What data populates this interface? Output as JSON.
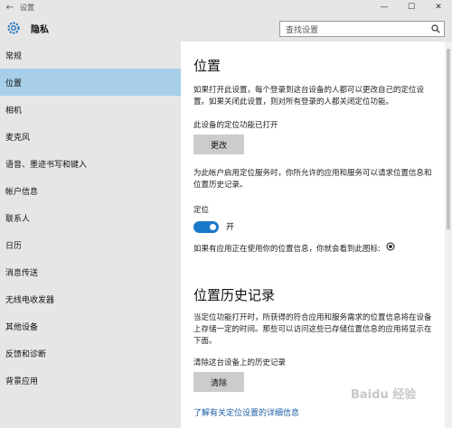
{
  "window": {
    "back": "←",
    "title": "设置",
    "min": "—",
    "max": "☐",
    "close": "✕"
  },
  "header": {
    "title": "隐私",
    "search_placeholder": "查找设置"
  },
  "sidebar": {
    "items": [
      {
        "label": "常规"
      },
      {
        "label": "位置"
      },
      {
        "label": "相机"
      },
      {
        "label": "麦克风"
      },
      {
        "label": "语音、墨迹书写和键入"
      },
      {
        "label": "帐户信息"
      },
      {
        "label": "联系人"
      },
      {
        "label": "日历"
      },
      {
        "label": "消息传送"
      },
      {
        "label": "无线电收发器"
      },
      {
        "label": "其他设备"
      },
      {
        "label": "反馈和诊断"
      },
      {
        "label": "背景应用"
      }
    ],
    "active": "位置"
  },
  "main": {
    "title": "位置",
    "desc": "如果打开此设置，每个登录到这台设备的人都可以更改自己的定位设置。如果关闭此设置，则对所有登录的人都关闭定位功能。",
    "device_status": "此设备的定位功能已打开",
    "change_button": "更改",
    "account_desc": "为此帐户启用定位服务时，你所允许的应用和服务可以请求位置信息和位置历史记录。",
    "location_label": "定位",
    "toggle_state": "开",
    "in_use_text": "如果有应用正在使用你的位置信息，你就会看到此图标:",
    "history_title": "位置历史记录",
    "history_desc": "当定位功能打开时，所获得的符合应用和服务需求的位置信息将在设备上存储一定的时间。那些可以访问这些已存储位置信息的应用将显示在下面。",
    "clear_label": "清除这台设备上的历史记录",
    "clear_button": "清除",
    "more_link": "了解有关定位设置的详细信息"
  },
  "colors": {
    "accent": "#1979ca",
    "sidebar_bg": "#e6e6e6",
    "active_bg": "#a7cfe9",
    "link": "#1c5ea6"
  },
  "watermark": "Baidu 经验"
}
